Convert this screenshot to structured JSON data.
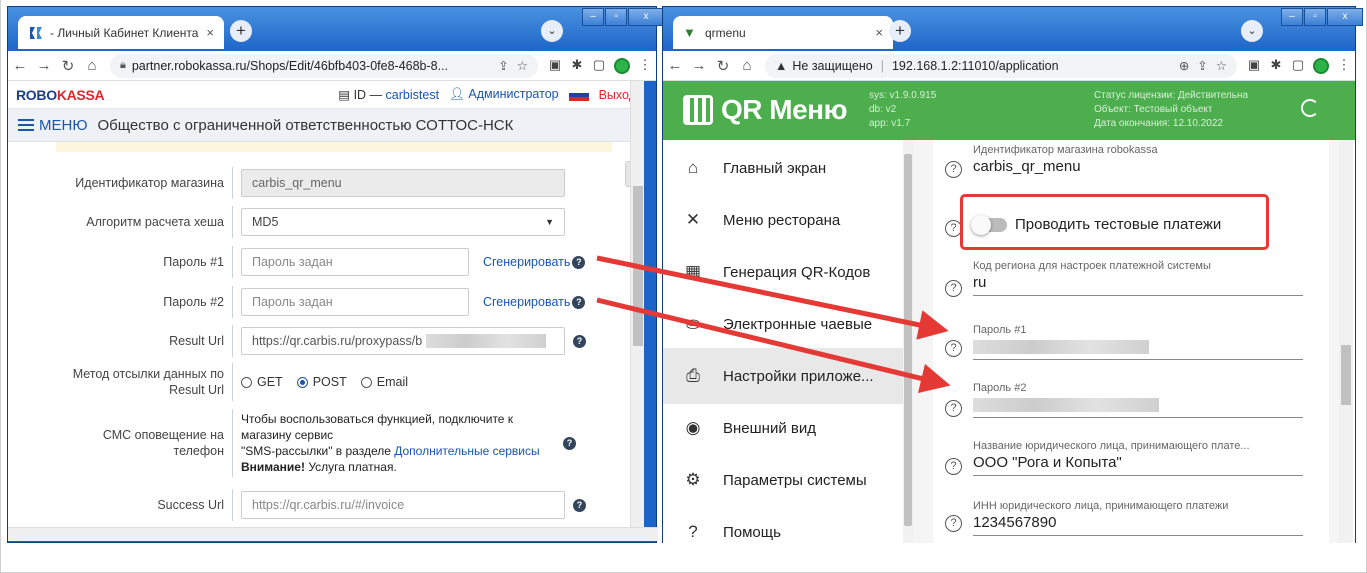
{
  "left_window": {
    "tab_title": "- Личный Кабинет Клиента",
    "url": "partner.robokassa.ru/Shops/Edit/46bfb403-0fe8-468b-8...",
    "header": {
      "logo_part1": "ROBO",
      "logo_part2": "KASSA",
      "id_label": "ID",
      "dash": "—",
      "login": "carbistest",
      "role": "Администратор",
      "exit": "Выход"
    },
    "menu_label": "МЕНЮ",
    "company": "Общество с ограниченной ответственностью СОТТОС-НСК",
    "rows": {
      "shop_id_label": "Идентификатор магазина",
      "shop_id_value": "carbis_qr_menu",
      "hash_label": "Алгоритм расчета хеша",
      "hash_value": "MD5",
      "pwd1_label": "Пароль #1",
      "pwd1_placeholder": "Пароль задан",
      "pwd2_label": "Пароль #2",
      "pwd2_placeholder": "Пароль задан",
      "generate": "Сгенерировать",
      "result_url_label": "Result Url",
      "result_url_value": "https://qr.carbis.ru/proxypass/b",
      "method_label_1": "Метод отсылки данных по",
      "method_label_2": "Result Url",
      "method_options": [
        "GET",
        "POST",
        "Email"
      ],
      "method_selected": "POST",
      "sms_label_1": "СМС оповещение на",
      "sms_label_2": "телефон",
      "sms_text_1": "Чтобы воспользоваться функцией, подключите к",
      "sms_text_2": "магазину сервис",
      "sms_text_3": "\"SMS-рассылки\" в разделе",
      "sms_link": "Дополнительные сервисы",
      "sms_warn_bold": "Внимание!",
      "sms_warn": "Услуга платная.",
      "success_url_label": "Success Url",
      "success_url_value": "https://qr.carbis.ru/#/invoice"
    }
  },
  "right_window": {
    "tab_title": "qrmenu",
    "security": "Не защищено",
    "url": "192.168.1.2:11010/application",
    "app_title": "QR Меню",
    "versions": [
      "sys: v1.9.0.915",
      "db: v2",
      "app: v1.7"
    ],
    "license": [
      "Статус лицензии: Действительна",
      "Объект: Тестовый объект",
      "Дата окончания: 12.10.2022"
    ],
    "menu": [
      {
        "label": "Главный экран",
        "icon": "home-icon",
        "glyph": "⌂"
      },
      {
        "label": "Меню ресторана",
        "icon": "cutlery-icon",
        "glyph": "✕"
      },
      {
        "label": "Генерация QR-Кодов",
        "icon": "qr-icon",
        "glyph": "▦"
      },
      {
        "label": "Электронные чаевые",
        "icon": "tips-icon",
        "glyph": "⛀"
      },
      {
        "label": "Настройки приложе...",
        "icon": "settings-app-icon",
        "glyph": "⎙"
      },
      {
        "label": "Внешний вид",
        "icon": "eye-icon",
        "glyph": "◉"
      },
      {
        "label": "Параметры системы",
        "icon": "gear-icon",
        "glyph": "⚙"
      },
      {
        "label": "Помощь",
        "icon": "help-icon",
        "glyph": "?"
      }
    ],
    "fields": {
      "shop_id_label": "Идентификатор магазина robokassa",
      "shop_id_value": "carbis_qr_menu",
      "test_payments": "Проводить тестовые платежи",
      "region_label": "Код региона для настроек платежной системы",
      "region_value": "ru",
      "pwd1_label": "Пароль #1",
      "pwd2_label": "Пароль #2",
      "legal_name_label": "Название юридического лица, принимающего плате...",
      "legal_name_value": "ООО \"Рога и Копыта\"",
      "inn_label": "ИНН юридического лица, принимающего платежи",
      "inn_value": "1234567890"
    }
  },
  "colors": {
    "accent_blue": "#1a55b0",
    "brand_red": "#e0262b",
    "qr_green": "#4cae4c",
    "arrow_red": "#e53935"
  }
}
